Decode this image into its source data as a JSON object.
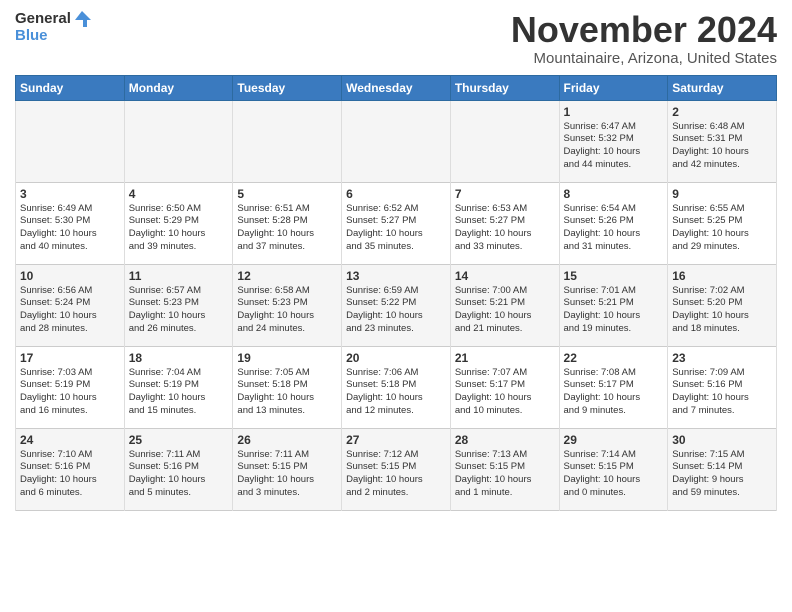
{
  "header": {
    "logo_general": "General",
    "logo_blue": "Blue",
    "month": "November 2024",
    "location": "Mountainaire, Arizona, United States"
  },
  "days_of_week": [
    "Sunday",
    "Monday",
    "Tuesday",
    "Wednesday",
    "Thursday",
    "Friday",
    "Saturday"
  ],
  "weeks": [
    [
      {
        "day": "",
        "info": ""
      },
      {
        "day": "",
        "info": ""
      },
      {
        "day": "",
        "info": ""
      },
      {
        "day": "",
        "info": ""
      },
      {
        "day": "",
        "info": ""
      },
      {
        "day": "1",
        "info": "Sunrise: 6:47 AM\nSunset: 5:32 PM\nDaylight: 10 hours\nand 44 minutes."
      },
      {
        "day": "2",
        "info": "Sunrise: 6:48 AM\nSunset: 5:31 PM\nDaylight: 10 hours\nand 42 minutes."
      }
    ],
    [
      {
        "day": "3",
        "info": "Sunrise: 6:49 AM\nSunset: 5:30 PM\nDaylight: 10 hours\nand 40 minutes."
      },
      {
        "day": "4",
        "info": "Sunrise: 6:50 AM\nSunset: 5:29 PM\nDaylight: 10 hours\nand 39 minutes."
      },
      {
        "day": "5",
        "info": "Sunrise: 6:51 AM\nSunset: 5:28 PM\nDaylight: 10 hours\nand 37 minutes."
      },
      {
        "day": "6",
        "info": "Sunrise: 6:52 AM\nSunset: 5:27 PM\nDaylight: 10 hours\nand 35 minutes."
      },
      {
        "day": "7",
        "info": "Sunrise: 6:53 AM\nSunset: 5:27 PM\nDaylight: 10 hours\nand 33 minutes."
      },
      {
        "day": "8",
        "info": "Sunrise: 6:54 AM\nSunset: 5:26 PM\nDaylight: 10 hours\nand 31 minutes."
      },
      {
        "day": "9",
        "info": "Sunrise: 6:55 AM\nSunset: 5:25 PM\nDaylight: 10 hours\nand 29 minutes."
      }
    ],
    [
      {
        "day": "10",
        "info": "Sunrise: 6:56 AM\nSunset: 5:24 PM\nDaylight: 10 hours\nand 28 minutes."
      },
      {
        "day": "11",
        "info": "Sunrise: 6:57 AM\nSunset: 5:23 PM\nDaylight: 10 hours\nand 26 minutes."
      },
      {
        "day": "12",
        "info": "Sunrise: 6:58 AM\nSunset: 5:23 PM\nDaylight: 10 hours\nand 24 minutes."
      },
      {
        "day": "13",
        "info": "Sunrise: 6:59 AM\nSunset: 5:22 PM\nDaylight: 10 hours\nand 23 minutes."
      },
      {
        "day": "14",
        "info": "Sunrise: 7:00 AM\nSunset: 5:21 PM\nDaylight: 10 hours\nand 21 minutes."
      },
      {
        "day": "15",
        "info": "Sunrise: 7:01 AM\nSunset: 5:21 PM\nDaylight: 10 hours\nand 19 minutes."
      },
      {
        "day": "16",
        "info": "Sunrise: 7:02 AM\nSunset: 5:20 PM\nDaylight: 10 hours\nand 18 minutes."
      }
    ],
    [
      {
        "day": "17",
        "info": "Sunrise: 7:03 AM\nSunset: 5:19 PM\nDaylight: 10 hours\nand 16 minutes."
      },
      {
        "day": "18",
        "info": "Sunrise: 7:04 AM\nSunset: 5:19 PM\nDaylight: 10 hours\nand 15 minutes."
      },
      {
        "day": "19",
        "info": "Sunrise: 7:05 AM\nSunset: 5:18 PM\nDaylight: 10 hours\nand 13 minutes."
      },
      {
        "day": "20",
        "info": "Sunrise: 7:06 AM\nSunset: 5:18 PM\nDaylight: 10 hours\nand 12 minutes."
      },
      {
        "day": "21",
        "info": "Sunrise: 7:07 AM\nSunset: 5:17 PM\nDaylight: 10 hours\nand 10 minutes."
      },
      {
        "day": "22",
        "info": "Sunrise: 7:08 AM\nSunset: 5:17 PM\nDaylight: 10 hours\nand 9 minutes."
      },
      {
        "day": "23",
        "info": "Sunrise: 7:09 AM\nSunset: 5:16 PM\nDaylight: 10 hours\nand 7 minutes."
      }
    ],
    [
      {
        "day": "24",
        "info": "Sunrise: 7:10 AM\nSunset: 5:16 PM\nDaylight: 10 hours\nand 6 minutes."
      },
      {
        "day": "25",
        "info": "Sunrise: 7:11 AM\nSunset: 5:16 PM\nDaylight: 10 hours\nand 5 minutes."
      },
      {
        "day": "26",
        "info": "Sunrise: 7:11 AM\nSunset: 5:15 PM\nDaylight: 10 hours\nand 3 minutes."
      },
      {
        "day": "27",
        "info": "Sunrise: 7:12 AM\nSunset: 5:15 PM\nDaylight: 10 hours\nand 2 minutes."
      },
      {
        "day": "28",
        "info": "Sunrise: 7:13 AM\nSunset: 5:15 PM\nDaylight: 10 hours\nand 1 minute."
      },
      {
        "day": "29",
        "info": "Sunrise: 7:14 AM\nSunset: 5:15 PM\nDaylight: 10 hours\nand 0 minutes."
      },
      {
        "day": "30",
        "info": "Sunrise: 7:15 AM\nSunset: 5:14 PM\nDaylight: 9 hours\nand 59 minutes."
      }
    ]
  ]
}
